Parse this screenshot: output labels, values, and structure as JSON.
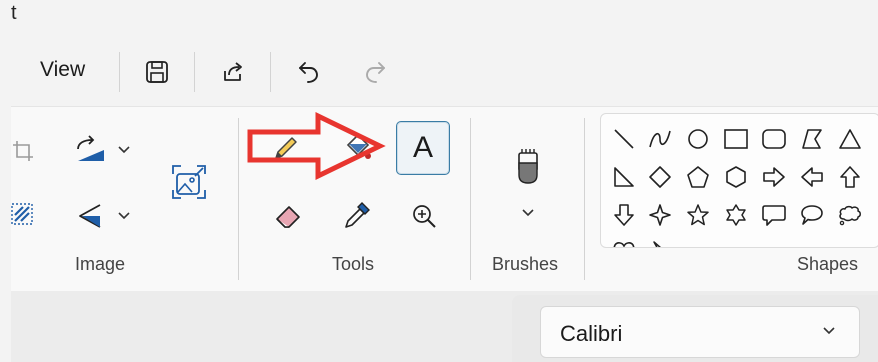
{
  "window": {
    "title_fragment": "t"
  },
  "menu": {
    "view_label": "View"
  },
  "quick_access": {
    "icons": [
      "save-icon",
      "share-icon",
      "undo-icon",
      "redo-icon"
    ]
  },
  "ribbon": {
    "groups": [
      {
        "label": "Image"
      },
      {
        "label": "Tools"
      },
      {
        "label": "Brushes"
      },
      {
        "label": "Shapes"
      }
    ],
    "tools": {
      "text_tool_label": "A",
      "icons": [
        "pencil-icon",
        "fill-bucket-icon",
        "text-icon",
        "eraser-icon",
        "color-picker-icon",
        "magnifier-icon"
      ]
    },
    "image": {
      "icons": [
        "crop-icon",
        "select-icon",
        "rotate-icon",
        "flip-icon",
        "resize-icon"
      ]
    },
    "brushes": {
      "icons": [
        "brush-icon",
        "chevron-down-icon"
      ]
    },
    "shapes": {
      "items": [
        "line",
        "curve",
        "oval",
        "rectangle",
        "rounded-rectangle",
        "polygon",
        "triangle",
        "right-triangle",
        "diamond",
        "pentagon",
        "hexagon",
        "right-arrow",
        "left-arrow",
        "up-arrow",
        "down-arrow",
        "four-point-star",
        "five-point-star",
        "six-point-star",
        "rounded-callout",
        "oval-callout",
        "cloud-callout"
      ]
    }
  },
  "annotation": {
    "arrow_color": "#e8352f"
  },
  "font": {
    "family_value": "Calibri"
  },
  "colors": {
    "accent": "#1f5ea8",
    "highlight_border": "#3a7ca5"
  }
}
